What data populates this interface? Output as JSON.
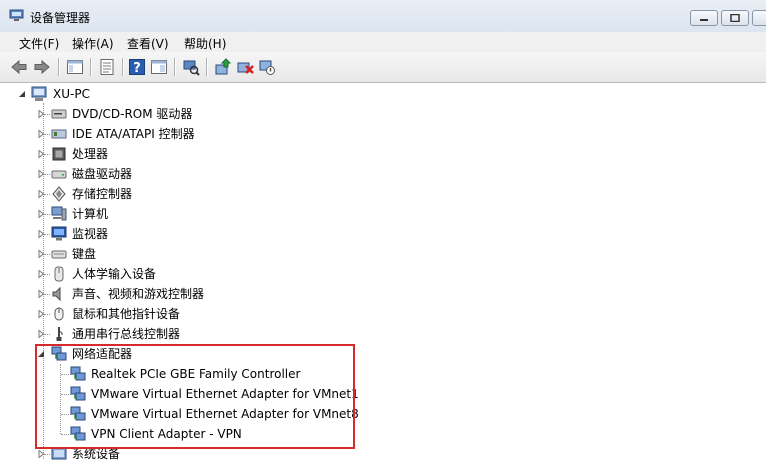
{
  "window": {
    "title": "设备管理器"
  },
  "menu": [
    {
      "label": "文件(F)"
    },
    {
      "label": "操作(A)"
    },
    {
      "label": "查看(V)"
    },
    {
      "label": "帮助(H)"
    }
  ],
  "tree": {
    "root": "XU-PC",
    "categories": [
      {
        "label": "DVD/CD-ROM 驱动器",
        "icon": "optical-drive-icon"
      },
      {
        "label": "IDE ATA/ATAPI 控制器",
        "icon": "ide-controller-icon"
      },
      {
        "label": "处理器",
        "icon": "processor-icon"
      },
      {
        "label": "磁盘驱动器",
        "icon": "disk-drive-icon"
      },
      {
        "label": "存储控制器",
        "icon": "storage-controller-icon"
      },
      {
        "label": "计算机",
        "icon": "computer-icon"
      },
      {
        "label": "监视器",
        "icon": "monitor-icon"
      },
      {
        "label": "键盘",
        "icon": "keyboard-icon"
      },
      {
        "label": "人体学输入设备",
        "icon": "hid-icon"
      },
      {
        "label": "声音、视频和游戏控制器",
        "icon": "sound-icon"
      },
      {
        "label": "鼠标和其他指针设备",
        "icon": "mouse-icon"
      },
      {
        "label": "通用串行总线控制器",
        "icon": "usb-icon"
      }
    ],
    "network": {
      "label": "网络适配器",
      "children": [
        "Realtek PCIe GBE Family Controller",
        "VMware Virtual Ethernet Adapter for VMnet1",
        "VMware Virtual Ethernet Adapter for VMnet8",
        "VPN Client Adapter - VPN"
      ]
    },
    "after": [
      {
        "label": "系统设备",
        "icon": "system-device-icon"
      }
    ]
  },
  "colors": {
    "highlight": "#d42a2a",
    "toolbar_bg": "#e8e8e8"
  }
}
